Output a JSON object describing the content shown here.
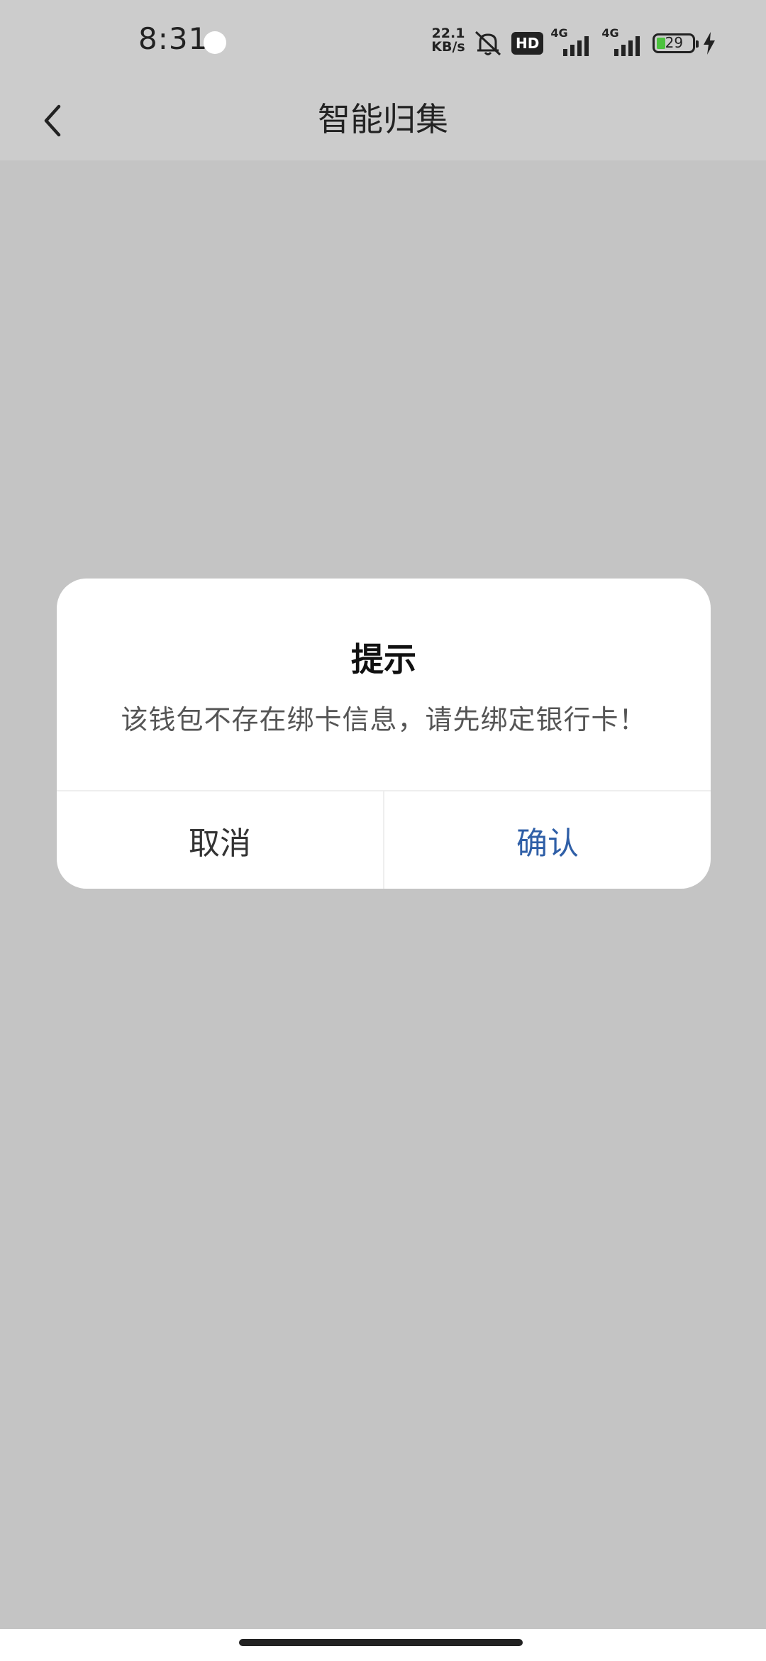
{
  "status_bar": {
    "time": "8:31",
    "net_speed_value": "22.1",
    "net_speed_unit": "KB/s",
    "hd_badge": "HD",
    "signal1_label": "4G",
    "signal2_label": "4G",
    "battery_level": "29"
  },
  "header": {
    "title": "智能归集"
  },
  "dialog": {
    "title": "提示",
    "message": "该钱包不存在绑卡信息，请先绑定银行卡！",
    "cancel_label": "取消",
    "confirm_label": "确认"
  },
  "colors": {
    "confirm_accent": "#2f5fa7",
    "battery_fill": "#4cc23e"
  }
}
